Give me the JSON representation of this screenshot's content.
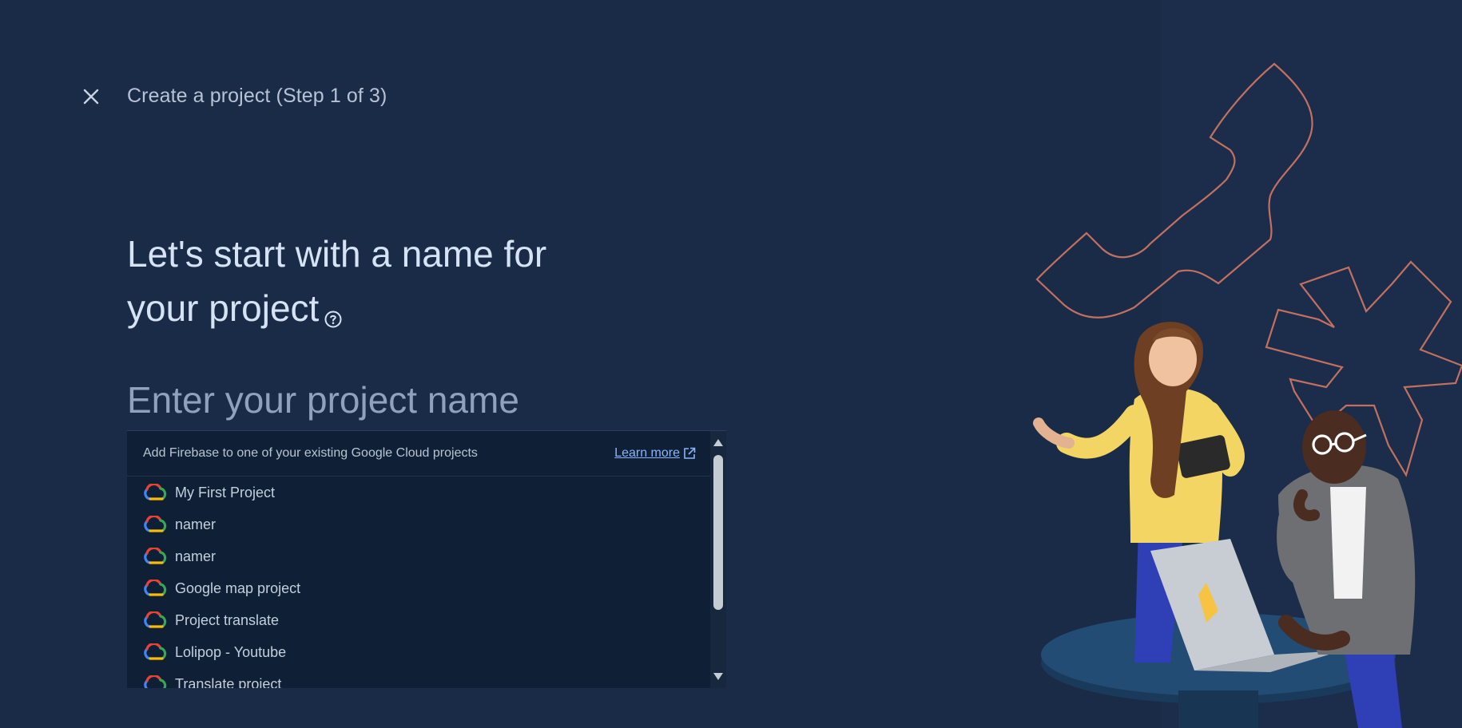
{
  "header": {
    "close_icon": "close-icon",
    "title": "Create a project (Step 1 of 3)"
  },
  "main": {
    "headline_line1": "Let's start with a name for",
    "headline_line2": "your project",
    "help_icon": "help-circle-icon",
    "name_input": {
      "value": "",
      "placeholder": "Enter your project name"
    }
  },
  "dropdown": {
    "header_text": "Add Firebase to one of your existing Google Cloud projects",
    "learn_more": "Learn more",
    "learn_more_icon": "open-in-new-icon",
    "item_icon": "google-cloud-icon",
    "items": [
      {
        "label": "My First Project"
      },
      {
        "label": "namer"
      },
      {
        "label": "namer"
      },
      {
        "label": "Google map project"
      },
      {
        "label": "Project translate"
      },
      {
        "label": "Lolipop - Youtube"
      },
      {
        "label": "Translate project"
      }
    ]
  },
  "colors": {
    "background": "#1a2b47",
    "dropdown_bg": "#0f2036",
    "link": "#8ab4f8",
    "accent_outline": "#c2705f"
  }
}
